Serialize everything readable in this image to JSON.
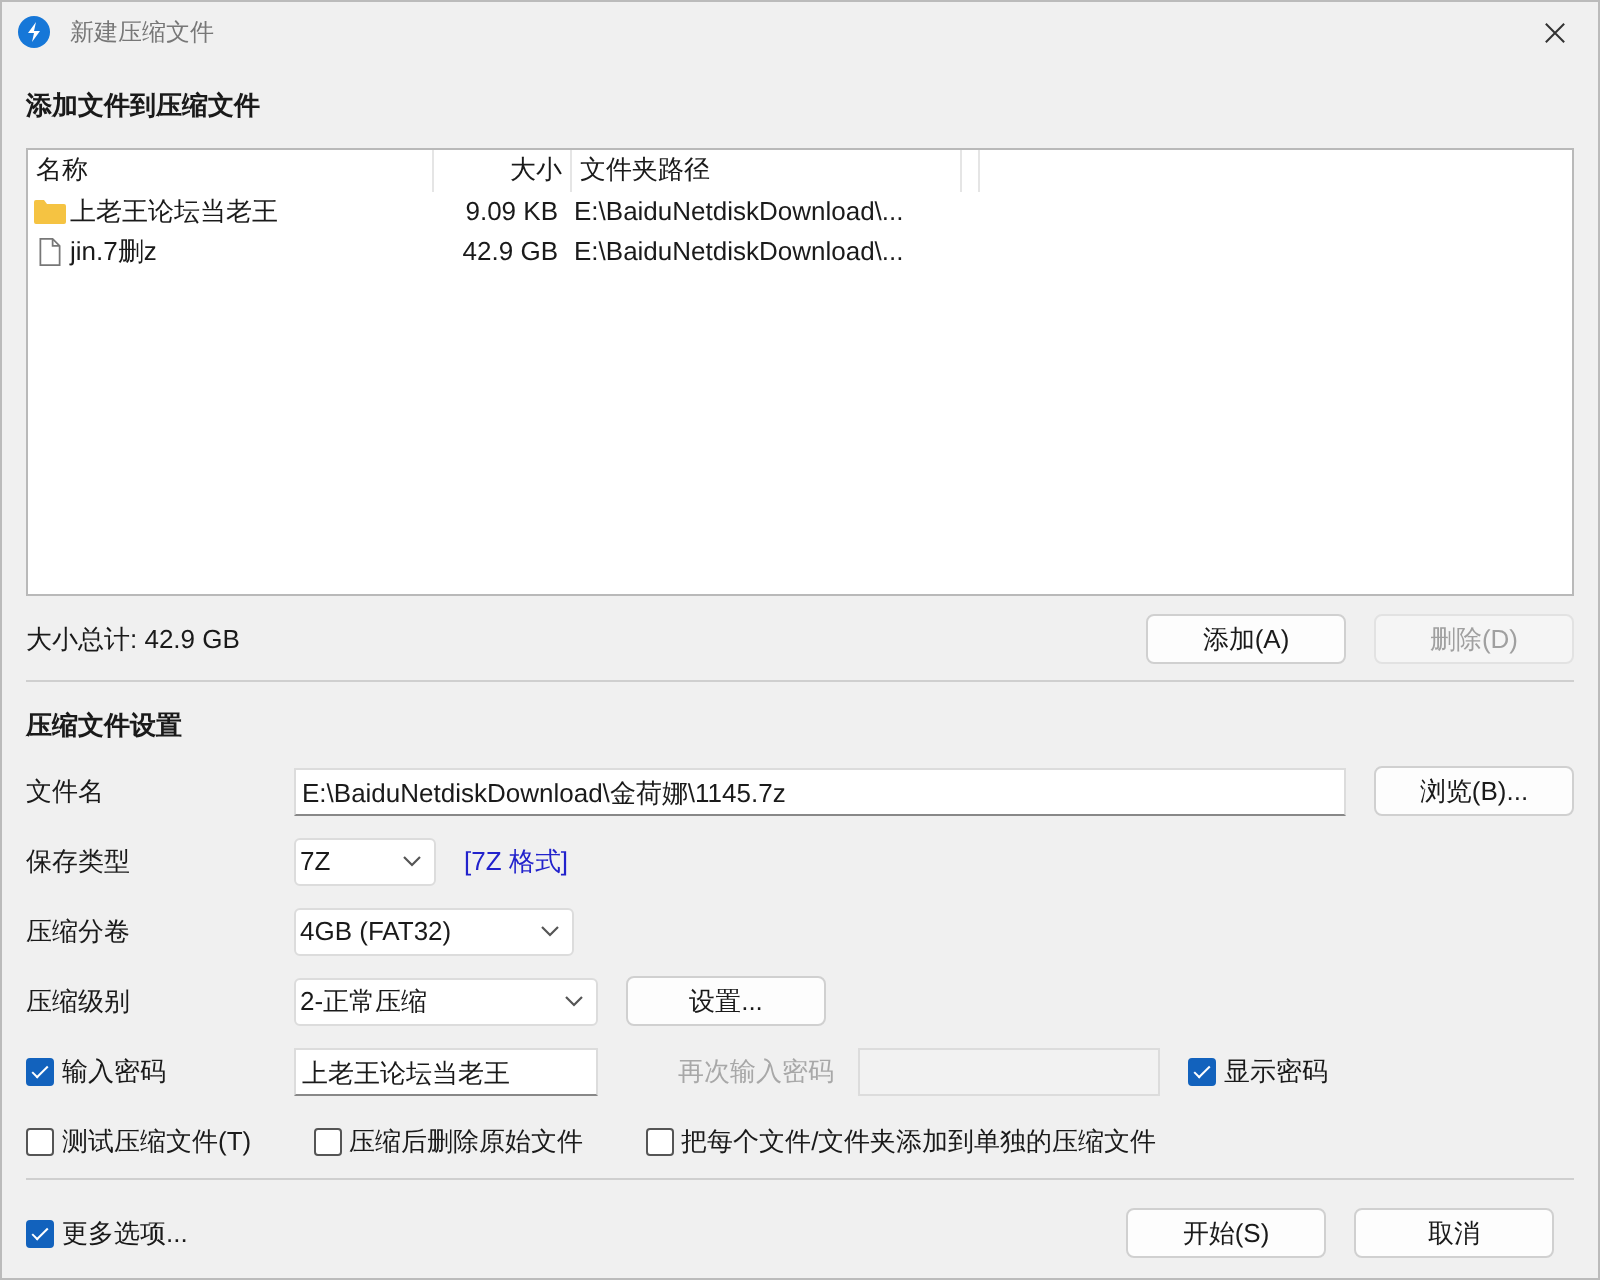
{
  "window": {
    "title": "新建压缩文件"
  },
  "files_section": {
    "heading": "添加文件到压缩文件",
    "columns": [
      "名称",
      "大小",
      "文件夹路径"
    ],
    "rows": [
      {
        "kind": "folder",
        "name": "上老王论坛当老王",
        "size": "9.09 KB",
        "path": "E:\\BaiduNetdiskDownload\\..."
      },
      {
        "kind": "file",
        "name": "jin.7删z",
        "size": "42.9 GB",
        "path": "E:\\BaiduNetdiskDownload\\..."
      }
    ],
    "total": "大小总计: 42.9 GB",
    "buttons": [
      {
        "label": "添加(A)",
        "disabled": false
      },
      {
        "label": "删除(D)",
        "disabled": true
      }
    ]
  },
  "settings": {
    "heading": "压缩文件设置",
    "filename": {
      "label": "文件名",
      "value": "E:\\BaiduNetdiskDownload\\金荷娜\\1145.7z",
      "button": "浏览(B)..."
    },
    "format": {
      "label": "保存类型",
      "value": "7Z",
      "link": "[7Z 格式]"
    },
    "split": {
      "label": "压缩分卷",
      "value": "4GB (FAT32)"
    },
    "level": {
      "label": "压缩级别",
      "value": "2-正常压缩",
      "button": "设置..."
    },
    "password": {
      "label": "输入密码",
      "checked": true,
      "value": "上老王论坛当老王",
      "confirm_label": "再次输入密码",
      "confirm_disabled": true,
      "show_label": "显示密码",
      "show_checked": true
    },
    "options": [
      {
        "label": "测试压缩文件(T)",
        "checked": false
      },
      {
        "label": "压缩后删除原始文件",
        "checked": false
      },
      {
        "label": "把每个文件/文件夹添加到单独的压缩文件",
        "checked": false
      }
    ]
  },
  "footer": {
    "more": {
      "label": "更多选项...",
      "checked": true
    },
    "buttons": [
      {
        "label": "开始(S)",
        "disabled": false
      },
      {
        "label": "取消",
        "disabled": false
      }
    ]
  }
}
